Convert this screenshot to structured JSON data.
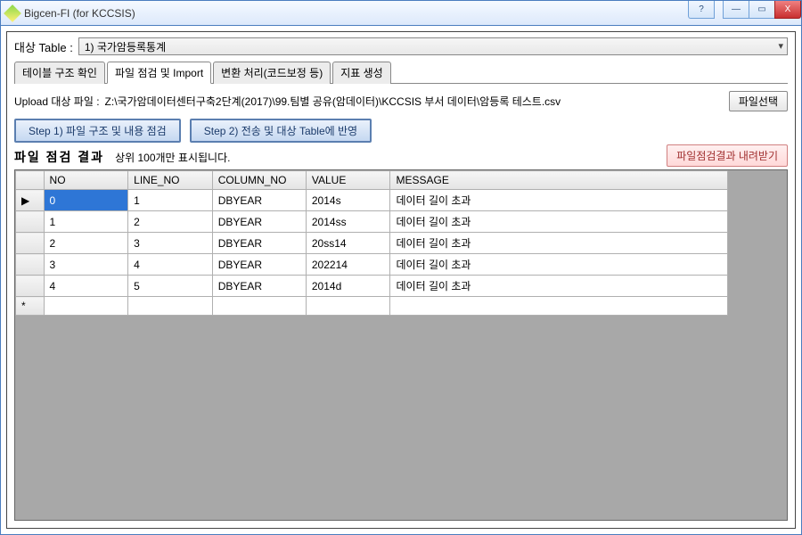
{
  "window": {
    "title": "Bigcen-FI (for KCCSIS)",
    "help": "?",
    "min": "—",
    "max": "▭",
    "close": "X"
  },
  "target_table": {
    "label": "대상 Table :",
    "value": "1)   국가암등록통계"
  },
  "tabs": [
    {
      "label": "테이블 구조 확인"
    },
    {
      "label": "파일 점검 및 Import"
    },
    {
      "label": "변환 처리(코드보정 등)"
    },
    {
      "label": "지표 생성"
    }
  ],
  "upload": {
    "label": "Upload 대상 파일   :",
    "path": "Z:\\국가암데이터센터구축2단계(2017)\\99.팀별 공유(암데이터)\\KCCSIS 부서 데이터\\암등록 테스트.csv",
    "browse": "파일선택"
  },
  "steps": {
    "step1": "Step 1) 파일 구조 및 내용 점검",
    "step2": "Step 2) 전송 및 대상 Table에 반영"
  },
  "result": {
    "title": "파일 점검 결과",
    "sub": "상위 100개만 표시됩니다.",
    "download": "파일점검결과 내려받기"
  },
  "grid": {
    "headers": {
      "no": "NO",
      "line": "LINE_NO",
      "col": "COLUMN_NO",
      "val": "VALUE",
      "msg": "MESSAGE"
    },
    "rows": [
      {
        "no": "0",
        "line": "1",
        "col": "DBYEAR",
        "val": "2014s",
        "msg": "데이터 길이 초과"
      },
      {
        "no": "1",
        "line": "2",
        "col": "DBYEAR",
        "val": "2014ss",
        "msg": "데이터 길이 초과"
      },
      {
        "no": "2",
        "line": "3",
        "col": "DBYEAR",
        "val": "20ss14",
        "msg": "데이터 길이 초과"
      },
      {
        "no": "3",
        "line": "4",
        "col": "DBYEAR",
        "val": "202214",
        "msg": "데이터 길이 초과"
      },
      {
        "no": "4",
        "line": "5",
        "col": "DBYEAR",
        "val": "2014d",
        "msg": "데이터 길이 초과"
      }
    ]
  },
  "row_marker": "▶",
  "new_marker": "*"
}
